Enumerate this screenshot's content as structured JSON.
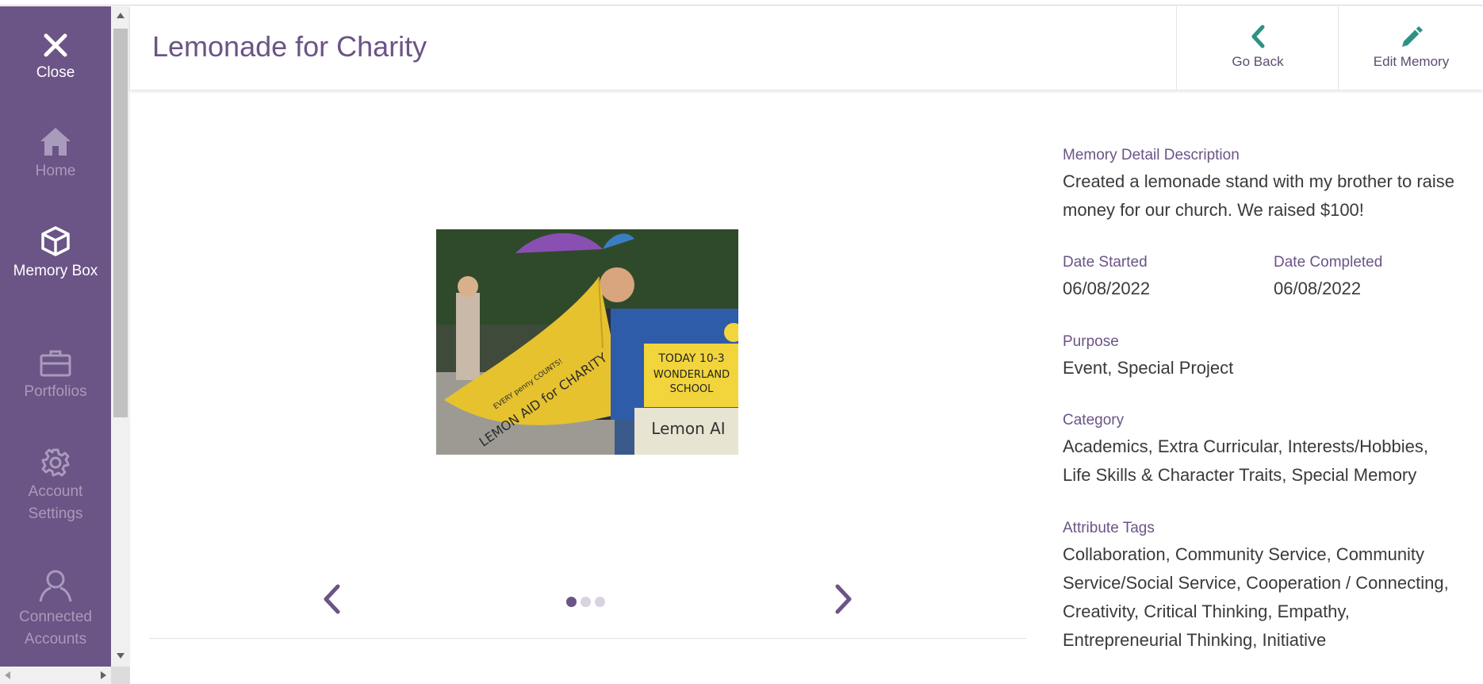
{
  "sidebar": {
    "items": [
      {
        "label": "Close",
        "icon": "close-icon"
      },
      {
        "label": "Home",
        "icon": "home-icon"
      },
      {
        "label": "Memory Box",
        "icon": "box-icon"
      },
      {
        "label": "Portfolios",
        "icon": "briefcase-icon"
      },
      {
        "label": "Account Settings",
        "icon": "gear-icon"
      },
      {
        "label": "Connected Accounts",
        "icon": "user-icon"
      }
    ],
    "active": "Memory Box"
  },
  "header": {
    "title": "Lemonade for Charity",
    "go_back_label": "Go Back",
    "edit_label": "Edit Memory"
  },
  "carousel": {
    "slide_count": 3,
    "current": 1
  },
  "photo_signs": {
    "lemon_text": "LEMON AID for CHARITY",
    "lemon_subtext": "EVERY penny COUNTS!",
    "sign_line1": "TODAY 10-3",
    "sign_line2": "WONDERLAND",
    "sign_line3": "SCHOOL",
    "sign_bottom": "Lemon AI"
  },
  "details": {
    "description_label": "Memory Detail Description",
    "description_line1": "Created a lemonade stand with my brother to raise",
    "description_line2": "money for our church. We raised $100!",
    "date_started_label": "Date Started",
    "date_started": "06/08/2022",
    "date_completed_label": "Date Completed",
    "date_completed": "06/08/2022",
    "purpose_label": "Purpose",
    "purpose": "Event, Special Project",
    "category_label": "Category",
    "category_line1": "Academics, Extra Curricular, Interests/Hobbies,",
    "category_line2": "Life Skills & Character Traits, Special Memory",
    "tags_label": "Attribute Tags",
    "tags_line1": "Collaboration, Community Service, Community",
    "tags_line2": "Service/Social Service, Cooperation / Connecting,",
    "tags_line3": "Creativity, Critical Thinking, Empathy,",
    "tags_line4": "Entrepreneurial Thinking, Initiative"
  },
  "colors": {
    "sidebar_bg": "#6b5486",
    "accent_teal": "#2f9185",
    "title_purple": "#6b5486"
  }
}
